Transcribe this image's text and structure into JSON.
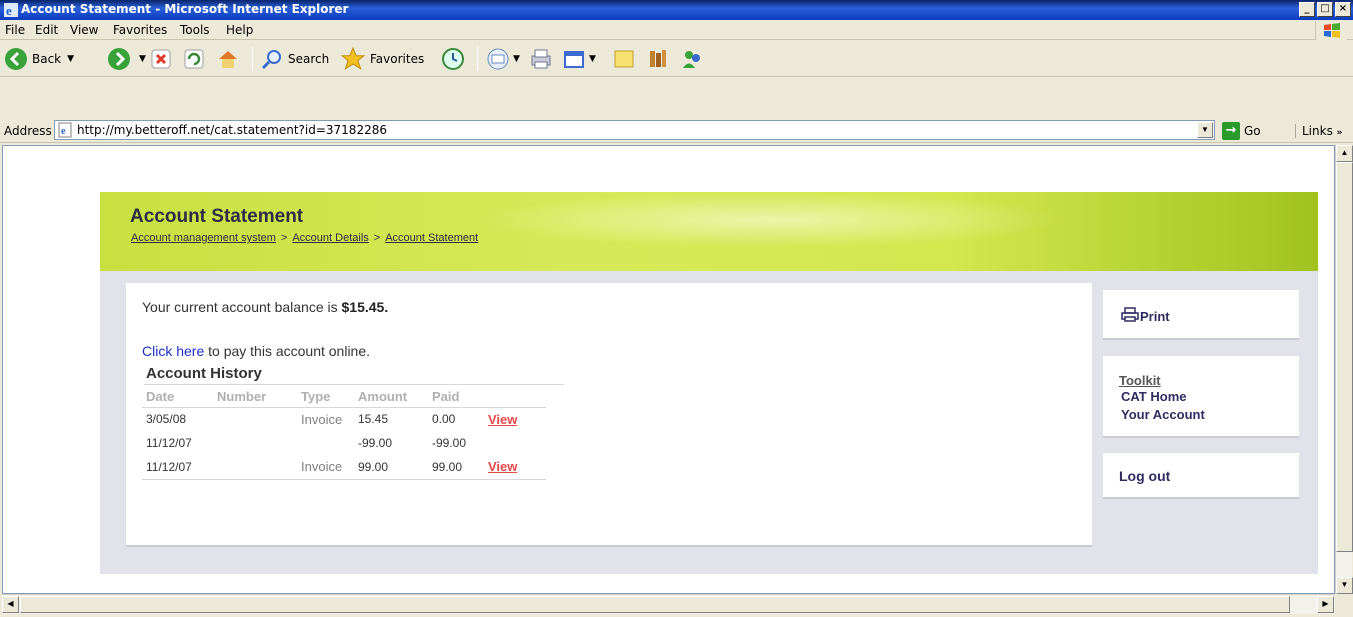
{
  "window": {
    "title": "Account Statement - Microsoft Internet Explorer",
    "min": "_",
    "max": "□",
    "close": "×"
  },
  "menu": [
    "File",
    "Edit",
    "View",
    "Favorites",
    "Tools",
    "Help"
  ],
  "toolbar": {
    "back": "Back",
    "search": "Search",
    "favorites": "Favorites"
  },
  "address": {
    "label": "Address",
    "url": "http://my.betteroff.net/cat.statement?id=37182286",
    "go": "Go",
    "links": "Links"
  },
  "page": {
    "title": "Account Statement",
    "breadcrumb": [
      "Account management system",
      "Account Details",
      "Account Statement"
    ],
    "balance_prefix": "Your current account balance is ",
    "balance_value": "$15.45.",
    "pay_link": "Click here",
    "pay_suffix": " to pay this account online.",
    "history_title": "Account History",
    "columns": [
      "Date",
      "Number",
      "Type",
      "Amount",
      "Paid",
      ""
    ],
    "rows": [
      {
        "date": "3/05/08",
        "number": "",
        "type": "Invoice",
        "amount": "15.45",
        "paid": "0.00",
        "action": "View"
      },
      {
        "date": "11/12/07",
        "number": "",
        "type": "",
        "amount": "-99.00",
        "paid": "-99.00",
        "action": ""
      },
      {
        "date": "11/12/07",
        "number": "",
        "type": "Invoice",
        "amount": "99.00",
        "paid": "99.00",
        "action": "View"
      }
    ]
  },
  "sidebar": {
    "print": "Print",
    "toolkit": "Toolkit",
    "cat_home": "CAT Home",
    "your_account": "Your Account",
    "logout": "Log out"
  }
}
